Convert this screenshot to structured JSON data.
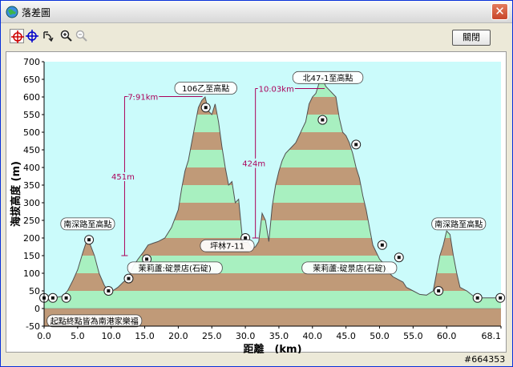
{
  "window": {
    "title": "落差圖",
    "app_icon": "globe-icon",
    "close_icon": "close-icon"
  },
  "toolbar": {
    "tools": [
      {
        "name": "crosshair-red-icon",
        "selected": true
      },
      {
        "name": "crosshair-blue-icon",
        "selected": false
      },
      {
        "name": "rotate-icon",
        "selected": false
      },
      {
        "name": "zoom-in-icon",
        "selected": false
      },
      {
        "name": "zoom-out-icon",
        "selected": false
      }
    ],
    "close_label": "關閉"
  },
  "watermark": "#664353",
  "colors": {
    "band_brown": "#c09a78",
    "band_green": "#a8f0c0",
    "plot_bg": "#cbfbfb",
    "annotation": "#aa005a",
    "line": "#505050"
  },
  "chart_data": {
    "type": "area",
    "xlabel": "距離　(km)",
    "ylabel": "海拔高度 (m)",
    "xlim": [
      0,
      68.1
    ],
    "ylim": [
      -50,
      700
    ],
    "x_ticks": [
      0,
      5,
      10,
      15,
      20,
      25,
      30,
      35,
      40,
      45,
      50,
      55,
      60,
      68.1
    ],
    "x_tick_labels": [
      "0.0",
      "5.0",
      "10.0",
      "15.0",
      "20.0",
      "25.0",
      "30.0",
      "35.0",
      "40.0",
      "45.0",
      "50.0",
      "55.0",
      "60.0",
      "68.1"
    ],
    "y_ticks": [
      -50,
      0,
      50,
      100,
      150,
      200,
      250,
      300,
      350,
      400,
      450,
      500,
      550,
      600,
      650,
      700
    ],
    "y_tick_labels": [
      "-50",
      "0",
      "50",
      "100",
      "150",
      "200",
      "250",
      "300",
      "350",
      "400",
      "450",
      "500",
      "550",
      "600",
      "650",
      "700"
    ],
    "band_step": 50,
    "profile": {
      "x": [
        0,
        1.3,
        2.0,
        2.8,
        3.5,
        4.3,
        5.0,
        5.8,
        6.4,
        6.9,
        7.5,
        8.2,
        9.0,
        9.6,
        10.2,
        11.0,
        11.8,
        12.5,
        13.3,
        14.0,
        14.8,
        15.5,
        16.2,
        17.0,
        18.0,
        19.0,
        20.0,
        20.5,
        21.0,
        21.5,
        22.0,
        22.5,
        23.0,
        23.5,
        24.0,
        24.5,
        25.0,
        25.5,
        26.0,
        26.5,
        27.0,
        27.5,
        28.0,
        28.5,
        29.0,
        29.5,
        30.0,
        30.5,
        31.0,
        31.5,
        32.0,
        32.5,
        33.0,
        33.5,
        34.0,
        34.5,
        35.0,
        35.5,
        36.0,
        36.5,
        37.0,
        37.5,
        38.0,
        38.5,
        39.0,
        39.5,
        40.0,
        40.5,
        41.0,
        41.5,
        42.0,
        42.5,
        43.0,
        43.5,
        44.0,
        44.5,
        45.0,
        45.5,
        46.0,
        46.5,
        47.0,
        47.5,
        48.0,
        48.5,
        49.0,
        49.5,
        50.0,
        50.5,
        51.0,
        51.5,
        52.0,
        52.5,
        53.0,
        53.5,
        54.0,
        55.0,
        56.0,
        57.0,
        58.0,
        58.5,
        59.0,
        59.5,
        60.0,
        60.5,
        61.0,
        61.5,
        62.0,
        63.0,
        64.0,
        65.0,
        66.0,
        67.0,
        68.1
      ],
      "y": [
        30,
        30,
        32,
        35,
        50,
        80,
        110,
        160,
        195,
        180,
        150,
        100,
        65,
        50,
        50,
        60,
        75,
        85,
        120,
        140,
        160,
        180,
        185,
        190,
        200,
        230,
        280,
        340,
        390,
        420,
        470,
        520,
        570,
        590,
        600,
        560,
        550,
        580,
        530,
        460,
        400,
        350,
        360,
        300,
        310,
        210,
        200,
        185,
        170,
        175,
        190,
        270,
        250,
        190,
        290,
        350,
        390,
        420,
        440,
        450,
        460,
        470,
        490,
        510,
        530,
        580,
        600,
        610,
        640,
        650,
        630,
        620,
        610,
        600,
        540,
        500,
        490,
        470,
        440,
        400,
        370,
        320,
        280,
        230,
        180,
        160,
        140,
        130,
        110,
        100,
        90,
        85,
        80,
        75,
        60,
        50,
        40,
        38,
        50,
        100,
        150,
        180,
        220,
        210,
        150,
        100,
        60,
        50,
        35,
        30,
        30,
        30,
        30,
        30,
        30
      ]
    },
    "points": [
      {
        "x": 0.0,
        "y": 30
      },
      {
        "x": 1.3,
        "y": 30
      },
      {
        "x": 3.3,
        "y": 30
      },
      {
        "x": 6.7,
        "y": 195
      },
      {
        "x": 9.6,
        "y": 50
      },
      {
        "x": 12.6,
        "y": 85
      },
      {
        "x": 15.3,
        "y": 140
      },
      {
        "x": 24.1,
        "y": 570
      },
      {
        "x": 30.0,
        "y": 200
      },
      {
        "x": 41.5,
        "y": 535
      },
      {
        "x": 46.5,
        "y": 465
      },
      {
        "x": 50.4,
        "y": 180
      },
      {
        "x": 52.9,
        "y": 145
      },
      {
        "x": 58.8,
        "y": 50
      },
      {
        "x": 64.6,
        "y": 30
      },
      {
        "x": 68.0,
        "y": 30
      }
    ],
    "labels": [
      {
        "text": "106乙至高點",
        "x": 24.1,
        "y": 625
      },
      {
        "text": "北47-1至高點",
        "x": 42.3,
        "y": 655
      },
      {
        "text": "南深路至高點",
        "x": 6.5,
        "y": 240
      },
      {
        "text": "南深路至高點",
        "x": 61.8,
        "y": 240
      },
      {
        "text": "坪林7-11",
        "x": 27.3,
        "y": 178
      },
      {
        "text": "茉莉蘆:碇景店(石碇)",
        "x": 19.5,
        "y": 115
      },
      {
        "text": "茉莉蘆:碇景店(石碇)",
        "x": 45.5,
        "y": 115
      },
      {
        "text": "起點終點皆為南港家樂福",
        "x": 7.5,
        "y": -35
      }
    ],
    "dimensions": [
      {
        "x": 12.0,
        "y_low": 150,
        "y_high": 601,
        "height_label": "451m",
        "span_label": "7.91km",
        "x_end": 24.1
      },
      {
        "x": 31.5,
        "y_low": 200,
        "y_high": 624,
        "height_label": "424m",
        "span_label": "10.03km",
        "x_end": 42.3
      }
    ]
  }
}
